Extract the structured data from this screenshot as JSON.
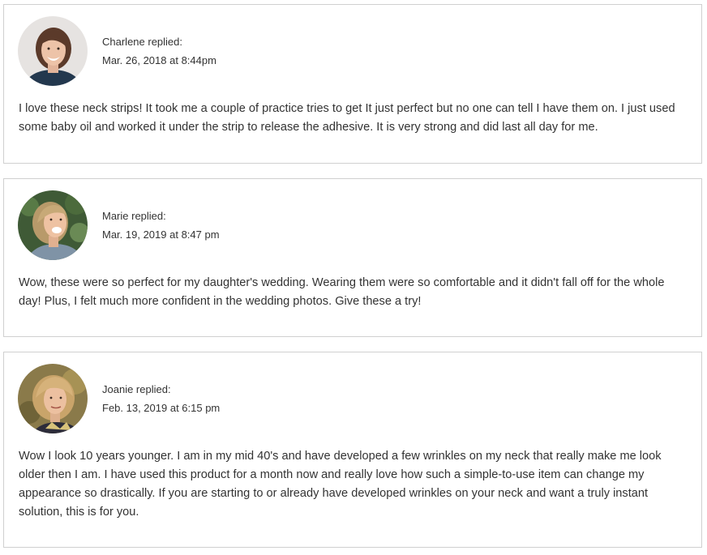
{
  "comments": [
    {
      "author_line": "Charlene replied:",
      "timestamp": "Mar. 26, 2018 at 8:44pm",
      "avatar_icon": "avatar-charlene-photo",
      "text": "I love these neck strips! It took me a couple of practice tries to get It just perfect but no one can tell I have them on. I just used some baby oil and worked it under the strip to release the adhesive. It is very strong and did last all day for me."
    },
    {
      "author_line": "Marie replied:",
      "timestamp": "Mar. 19, 2019 at 8:47 pm",
      "avatar_icon": "avatar-marie-photo",
      "text": "Wow, these were so perfect for my daughter's wedding. Wearing them were so comfortable and it didn't fall off for the whole day! Plus, I felt much more confident in the wedding photos. Give these a try!"
    },
    {
      "author_line": "Joanie replied:",
      "timestamp": "Feb. 13, 2019 at 6:15 pm",
      "avatar_icon": "avatar-joanie-photo",
      "text": "Wow I look 10 years younger. I am in my mid 40's and have developed a few wrinkles on my neck that really make me look older then I am. I have used this product for a month now and really love how such a simple-to-use item can change my appearance so drastically. If you are starting to or already have developed wrinkles on your neck and want a truly instant solution, this is for you."
    }
  ],
  "colors": {
    "text": "#333333",
    "border": "#d0d0d0",
    "background": "#ffffff"
  }
}
